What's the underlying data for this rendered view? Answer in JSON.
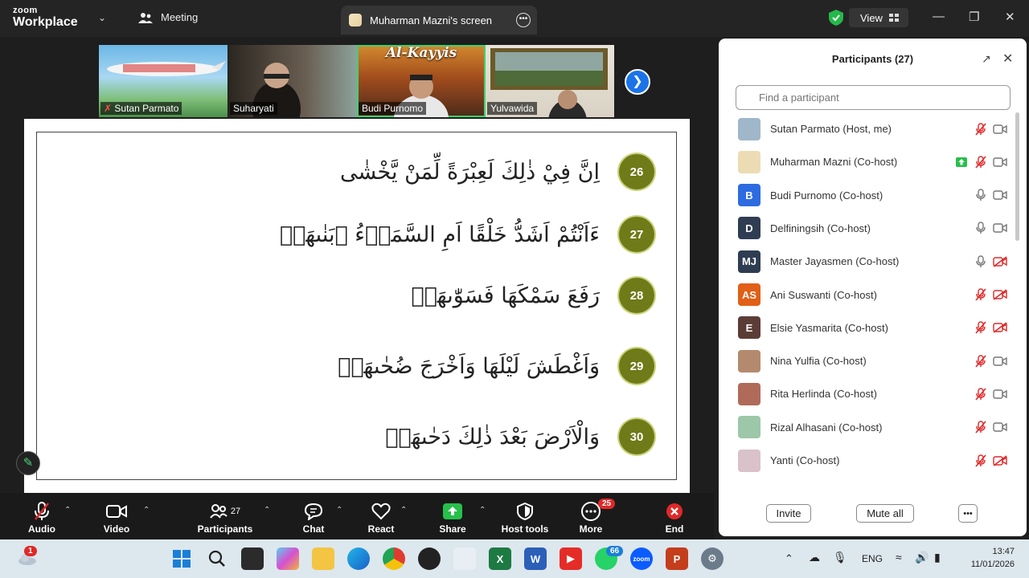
{
  "titlebar": {
    "brand_small": "zoom",
    "brand_large": "Workplace",
    "meeting_tab": "Meeting",
    "screen_tab": "Muharman Mazni's screen",
    "view_label": "View"
  },
  "thumbnails": [
    {
      "name": "Sutan Parmato"
    },
    {
      "name": "Suharyati"
    },
    {
      "name": "Budi Purnomo",
      "banner": "Al-Kayyis"
    },
    {
      "name": "Yulvawida"
    }
  ],
  "verses": [
    {
      "num": "26",
      "text": "اِنَّ فِيْ ذٰلِكَ لَعِبْرَةً لِّمَنْ يَّخْشٰى"
    },
    {
      "num": "27",
      "text": "ءَاَنْتُمْ اَشَدُّ خَلْقًا اَمِ السَّمَاۤءُ ۚبَنٰىهَاۗ"
    },
    {
      "num": "28",
      "text": "رَفَعَ سَمْكَهَا فَسَوّٰىهَاۙ"
    },
    {
      "num": "29",
      "text": "وَاَغْطَشَ لَيْلَهَا وَاَخْرَجَ ضُحٰىهَاۖ"
    },
    {
      "num": "30",
      "text": "وَالْاَرْضَ بَعْدَ ذٰلِكَ دَحٰىهَاۗ"
    }
  ],
  "toolbar": {
    "audio": "Audio",
    "video": "Video",
    "participants": "Participants",
    "participants_count": "27",
    "chat": "Chat",
    "react": "React",
    "share": "Share",
    "host_tools": "Host tools",
    "more": "More",
    "more_badge": "25",
    "end": "End"
  },
  "panel": {
    "title": "Participants (27)",
    "search_placeholder": "Find a participant",
    "invite": "Invite",
    "mute_all": "Mute all",
    "participants": [
      {
        "name": "Sutan Parmato (Host, me)",
        "initials": "",
        "color": "#9fb7c9",
        "mic": "muted",
        "cam": "on"
      },
      {
        "name": "Muharman Mazni (Co-host)",
        "initials": "",
        "color": "#ecdcb4",
        "mic": "muted",
        "cam": "on",
        "sharing": true
      },
      {
        "name": "Budi Purnomo (Co-host)",
        "initials": "B",
        "color": "#2d6be0",
        "mic": "on",
        "cam": "on"
      },
      {
        "name": "Delfiningsih (Co-host)",
        "initials": "D",
        "color": "#2f3d52",
        "mic": "on",
        "cam": "on"
      },
      {
        "name": "Master Jayasmen (Co-host)",
        "initials": "MJ",
        "color": "#2f3d52",
        "mic": "on",
        "cam": "off"
      },
      {
        "name": "Ani Suswanti (Co-host)",
        "initials": "AS",
        "color": "#e15f16",
        "mic": "muted",
        "cam": "off"
      },
      {
        "name": "Elsie Yasmarita (Co-host)",
        "initials": "E",
        "color": "#5b3d36",
        "mic": "muted",
        "cam": "off"
      },
      {
        "name": "Nina Yulfia (Co-host)",
        "initials": "",
        "color": "#b48a6e",
        "mic": "muted",
        "cam": "on"
      },
      {
        "name": "Rita Herlinda (Co-host)",
        "initials": "",
        "color": "#b06a5a",
        "mic": "muted",
        "cam": "on"
      },
      {
        "name": "Rizal Alhasani (Co-host)",
        "initials": "",
        "color": "#9cc7a8",
        "mic": "muted",
        "cam": "on"
      },
      {
        "name": "Yanti (Co-host)",
        "initials": "",
        "color": "#d9c2c9",
        "mic": "muted",
        "cam": "off"
      }
    ]
  },
  "taskbar": {
    "notification_badge": "1",
    "whatsapp_badge": "66",
    "lang": "ENG",
    "time": "13:47",
    "date": "11/01/2026"
  },
  "colors": {
    "verse_badge": "#6f7a18",
    "accent_blue": "#1a73e8",
    "share_green": "#26c04b",
    "mute_red": "#e02828"
  }
}
